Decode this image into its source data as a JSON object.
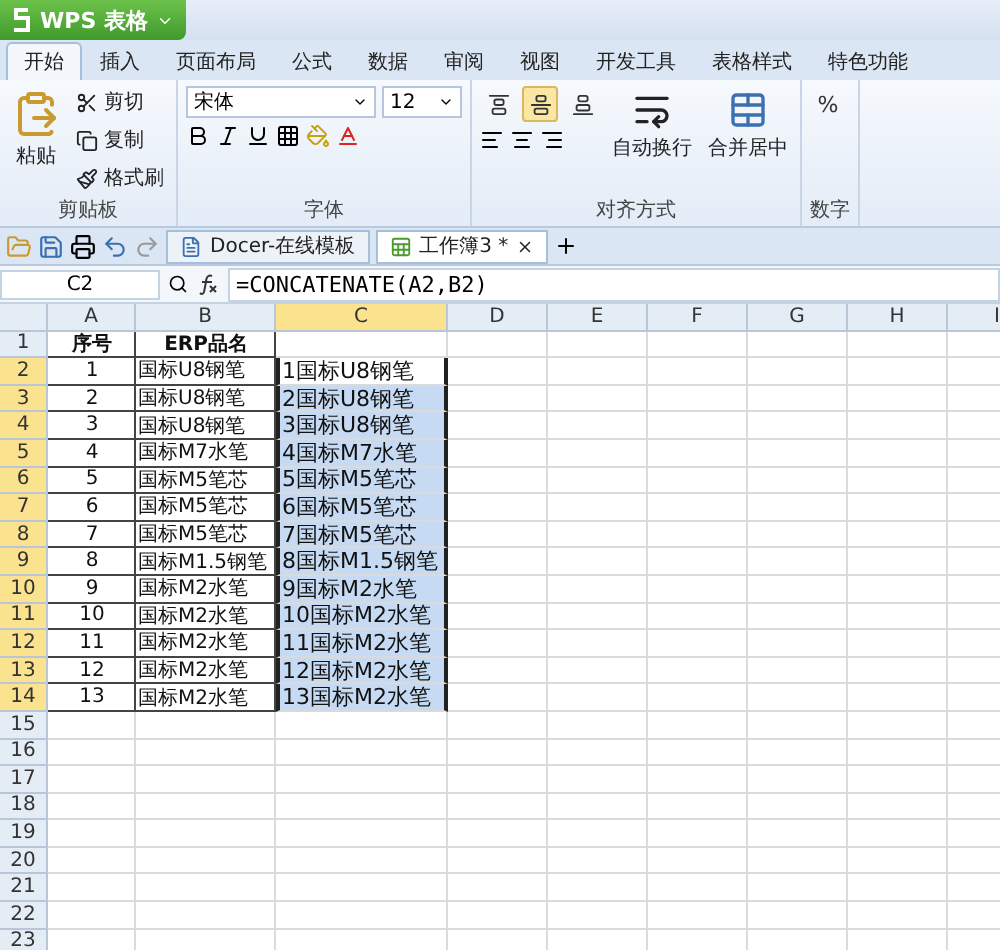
{
  "app_button": {
    "label": "WPS 表格"
  },
  "ribbon_tabs": [
    {
      "label": "开始",
      "selected": true
    },
    {
      "label": "插入",
      "selected": false
    },
    {
      "label": "页面布局",
      "selected": false
    },
    {
      "label": "公式",
      "selected": false
    },
    {
      "label": "数据",
      "selected": false
    },
    {
      "label": "审阅",
      "selected": false
    },
    {
      "label": "视图",
      "selected": false
    },
    {
      "label": "开发工具",
      "selected": false
    },
    {
      "label": "表格样式",
      "selected": false
    },
    {
      "label": "特色功能",
      "selected": false
    }
  ],
  "clipboard": {
    "title": "剪贴板",
    "paste": "粘贴",
    "items": [
      "剪切",
      "复制",
      "格式刷"
    ]
  },
  "font": {
    "title": "字体",
    "name": "宋体",
    "size": "12"
  },
  "alignment": {
    "title": "对齐方式",
    "vertical": [
      {
        "selected": false
      },
      {
        "selected": true
      },
      {
        "selected": false
      }
    ],
    "wrap": "自动换行",
    "merge": "合并居中"
  },
  "number": {
    "title": "数字",
    "percent": "%"
  },
  "doc_tabs": [
    {
      "label": "Docer-在线模板",
      "selected": false
    },
    {
      "label": "工作簿3 *",
      "selected": true
    }
  ],
  "formula_bar": {
    "name_box": "C2",
    "formula": "=CONCATENATE(A2,B2)"
  },
  "columns": [
    {
      "label": "A",
      "selected": false
    },
    {
      "label": "B",
      "selected": false
    },
    {
      "label": "C",
      "selected": true
    },
    {
      "label": "D",
      "selected": false
    },
    {
      "label": "E",
      "selected": false
    },
    {
      "label": "F",
      "selected": false
    },
    {
      "label": "G",
      "selected": false
    },
    {
      "label": "H",
      "selected": false
    },
    {
      "label": "I",
      "selected": false
    }
  ],
  "rows": [
    {
      "label": "1",
      "selected": false,
      "cells": [
        {
          "text": "序号",
          "kind": "header"
        },
        {
          "text": "ERP品名",
          "kind": "header"
        }
      ]
    },
    {
      "label": "2",
      "selected": true,
      "cells": [
        {
          "text": "1"
        },
        {
          "text": "国标U8钢笔"
        },
        {
          "text": "1国标U8钢笔",
          "selected": true,
          "active": true
        }
      ]
    },
    {
      "label": "3",
      "selected": true,
      "cells": [
        {
          "text": "2"
        },
        {
          "text": "国标U8钢笔"
        },
        {
          "text": "2国标U8钢笔",
          "selected": true,
          "active": false
        }
      ]
    },
    {
      "label": "4",
      "selected": true,
      "cells": [
        {
          "text": "3"
        },
        {
          "text": "国标U8钢笔"
        },
        {
          "text": "3国标U8钢笔",
          "selected": true,
          "active": false
        }
      ]
    },
    {
      "label": "5",
      "selected": true,
      "cells": [
        {
          "text": "4"
        },
        {
          "text": "国标M7水笔"
        },
        {
          "text": "4国标M7水笔",
          "selected": true,
          "active": false
        }
      ]
    },
    {
      "label": "6",
      "selected": true,
      "cells": [
        {
          "text": "5"
        },
        {
          "text": "国标M5笔芯"
        },
        {
          "text": "5国标M5笔芯",
          "selected": true,
          "active": false
        }
      ]
    },
    {
      "label": "7",
      "selected": true,
      "cells": [
        {
          "text": "6"
        },
        {
          "text": "国标M5笔芯"
        },
        {
          "text": "6国标M5笔芯",
          "selected": true,
          "active": false
        }
      ]
    },
    {
      "label": "8",
      "selected": true,
      "cells": [
        {
          "text": "7"
        },
        {
          "text": "国标M5笔芯"
        },
        {
          "text": "7国标M5笔芯",
          "selected": true,
          "active": false
        }
      ]
    },
    {
      "label": "9",
      "selected": true,
      "cells": [
        {
          "text": "8"
        },
        {
          "text": "国标M1.5钢笔"
        },
        {
          "text": "8国标M1.5钢笔",
          "selected": true,
          "active": false
        }
      ]
    },
    {
      "label": "10",
      "selected": true,
      "cells": [
        {
          "text": "9"
        },
        {
          "text": "国标M2水笔"
        },
        {
          "text": "9国标M2水笔",
          "selected": true,
          "active": false
        }
      ]
    },
    {
      "label": "11",
      "selected": true,
      "cells": [
        {
          "text": "10"
        },
        {
          "text": "国标M2水笔"
        },
        {
          "text": "10国标M2水笔",
          "selected": true,
          "active": false
        }
      ]
    },
    {
      "label": "12",
      "selected": true,
      "cells": [
        {
          "text": "11"
        },
        {
          "text": "国标M2水笔"
        },
        {
          "text": "11国标M2水笔",
          "selected": true,
          "active": false
        }
      ]
    },
    {
      "label": "13",
      "selected": true,
      "cells": [
        {
          "text": "12"
        },
        {
          "text": "国标M2水笔"
        },
        {
          "text": "12国标M2水笔",
          "selected": true,
          "active": false
        }
      ]
    },
    {
      "label": "14",
      "selected": true,
      "cells": [
        {
          "text": "13"
        },
        {
          "text": "国标M2水笔"
        },
        {
          "text": "13国标M2水笔",
          "selected": true,
          "active": false
        }
      ]
    },
    {
      "label": "15",
      "selected": false
    },
    {
      "label": "16",
      "selected": false
    },
    {
      "label": "17",
      "selected": false
    },
    {
      "label": "18",
      "selected": false
    },
    {
      "label": "19",
      "selected": false
    },
    {
      "label": "20",
      "selected": false
    },
    {
      "label": "21",
      "selected": false
    },
    {
      "label": "22",
      "selected": false
    },
    {
      "label": "23",
      "selected": false
    }
  ]
}
